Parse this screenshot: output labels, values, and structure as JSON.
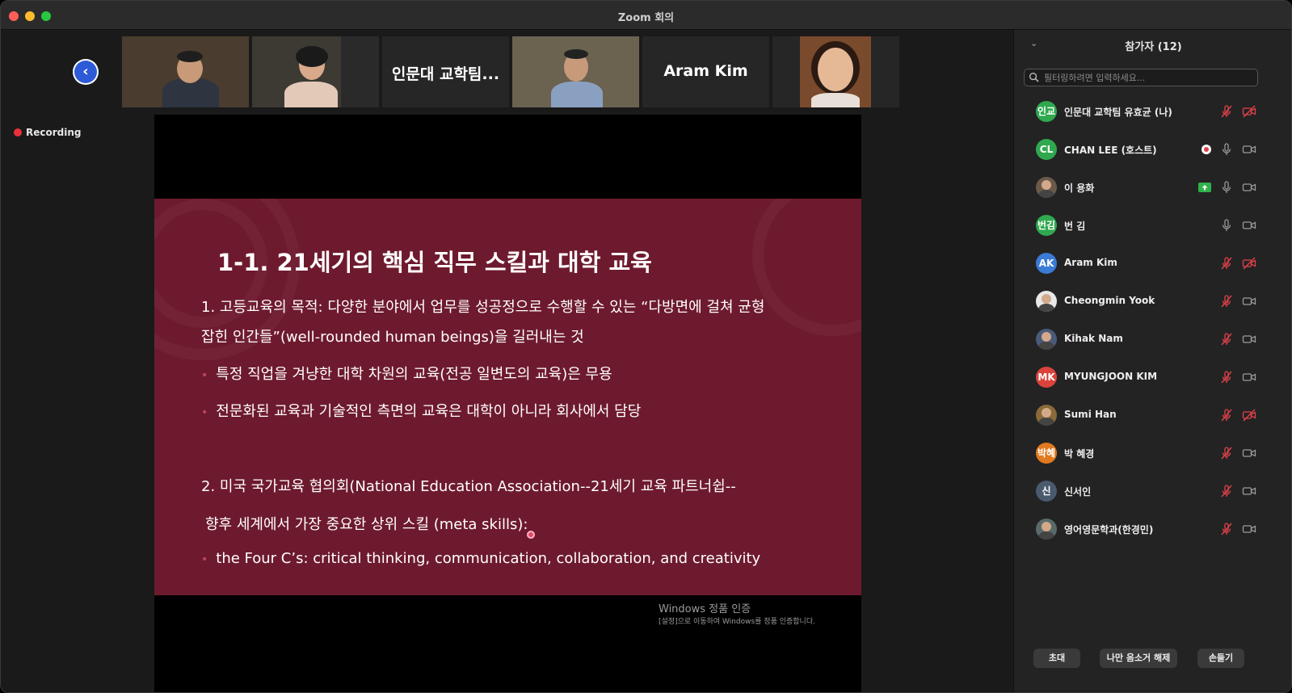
{
  "window": {
    "title": "Zoom 회의"
  },
  "recording": {
    "label": "Recording"
  },
  "video_strip": {
    "tiles": [
      {
        "name": ""
      },
      {
        "name": ""
      },
      {
        "name": "인문대 교학팀..."
      },
      {
        "name": ""
      },
      {
        "name": "Aram Kim"
      },
      {
        "name": ""
      }
    ]
  },
  "slide": {
    "title": "1-1. 21세기의 핵심 직무 스킬과 대학 교육",
    "line1": "1. 고등교육의 목적: 다양한 분야에서 업무를 성공정으로 수행할 수 있는 “다방면에 걸쳐 균형",
    "line2": "잡힌 인간들”(well-rounded human beings)을 길러내는 것",
    "bullet1": "특정 직업을 겨냥한 대학 차원의 교육(전공 일변도의 교육)은 무용",
    "bullet2": "전문화된 교육과 기술적인 측면의 교육은 대학이 아니라 회사에서 담당",
    "line3": "2. 미국 국가교육 협의회(National Education Association--21세기 교육 파트너쉽--",
    "line4": "향후 세계에서 가장 중요한 상위 스킬 (meta skills):",
    "bullet3": "the Four C’s: critical thinking, communication, collaboration, and creativity"
  },
  "watermark": {
    "title": "Windows 정품 인증",
    "subtitle": "[설정]으로 이동하여 Windows를 정품 인증합니다."
  },
  "participants": {
    "title": "참가자 (12)",
    "search_placeholder": "필터링하려면 입력하세요...",
    "items": [
      {
        "initials": "인교",
        "name": "인문대 교학팀 유효균 (나)",
        "avatar_color": "#2fa84f",
        "mic": "muted",
        "cam": "off"
      },
      {
        "initials": "CL",
        "name": "CHAN LEE (호스트)",
        "avatar_color": "#2fa84f",
        "mic": "on",
        "cam": "on",
        "recording": true
      },
      {
        "initials": "",
        "name": "이 용화",
        "avatar_color": "#6b5a4a",
        "mic": "on",
        "cam": "on",
        "sharing": true
      },
      {
        "initials": "번김",
        "name": "번 김",
        "avatar_color": "#2fa84f",
        "mic": "on",
        "cam": "on"
      },
      {
        "initials": "AK",
        "name": "Aram Kim",
        "avatar_color": "#3a7bd5",
        "mic": "muted",
        "cam": "off"
      },
      {
        "initials": "",
        "name": "Cheongmin Yook",
        "avatar_color": "#e8e8e8",
        "mic": "muted",
        "cam": "on"
      },
      {
        "initials": "",
        "name": "Kihak Nam",
        "avatar_color": "#4a5a7a",
        "mic": "muted",
        "cam": "on"
      },
      {
        "initials": "MK",
        "name": "MYUNGJOON KIM",
        "avatar_color": "#d9433b",
        "mic": "muted",
        "cam": "on"
      },
      {
        "initials": "",
        "name": "Sumi Han",
        "avatar_color": "#8a6a3a",
        "mic": "muted",
        "cam": "off"
      },
      {
        "initials": "박혜",
        "name": "박 혜경",
        "avatar_color": "#e07a1f",
        "mic": "muted",
        "cam": "on"
      },
      {
        "initials": "신",
        "name": "신서인",
        "avatar_color": "#4a5a6e",
        "mic": "muted",
        "cam": "on"
      },
      {
        "initials": "",
        "name": "영어영문학과(한경민)",
        "avatar_color": "#5a6a6a",
        "mic": "muted",
        "cam": "on"
      }
    ]
  },
  "footer": {
    "invite": "초대",
    "unmute_me": "나만 음소거 해제",
    "raise_hand": "손들기"
  }
}
